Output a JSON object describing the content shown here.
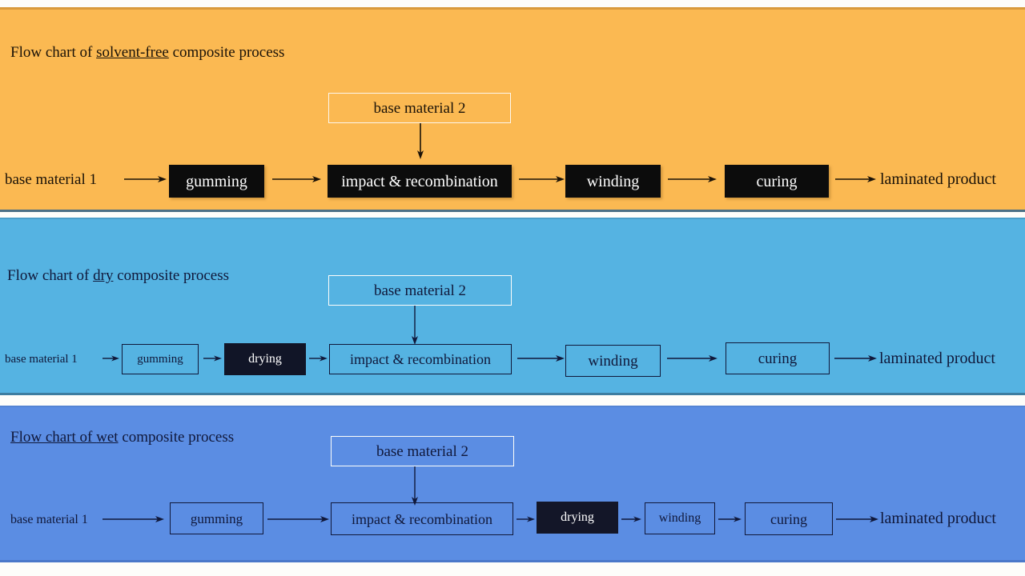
{
  "panels": [
    {
      "id": "solvent-free",
      "background": "#fbb952",
      "title_prefix": "Flow chart of ",
      "title_keyword": "solvent-free",
      "title_suffix": " composite process",
      "side_input_label": "base material  2",
      "start_label": "base material 1",
      "end_label": "laminated product",
      "steps": [
        "gumming",
        "impact & recombination",
        "winding",
        "curing"
      ]
    },
    {
      "id": "dry",
      "background": "#55b3e2",
      "title_prefix": "Flow chart of ",
      "title_keyword": "dry",
      "title_suffix": " composite process",
      "side_input_label": "base material  2",
      "start_label": "base material 1",
      "end_label": "laminated product",
      "steps": [
        "gumming",
        "drying",
        "impact & recombination",
        "winding",
        "curing"
      ]
    },
    {
      "id": "wet",
      "background": "#5b8de3",
      "title_prefix": "Flow chart of ",
      "title_keyword": "wet",
      "title_suffix": " composite process",
      "side_input_label": "base material  2",
      "start_label": "base material 1",
      "end_label": "laminated product",
      "steps": [
        "gumming",
        "impact & recombination",
        "drying",
        "winding",
        "curing"
      ]
    }
  ]
}
